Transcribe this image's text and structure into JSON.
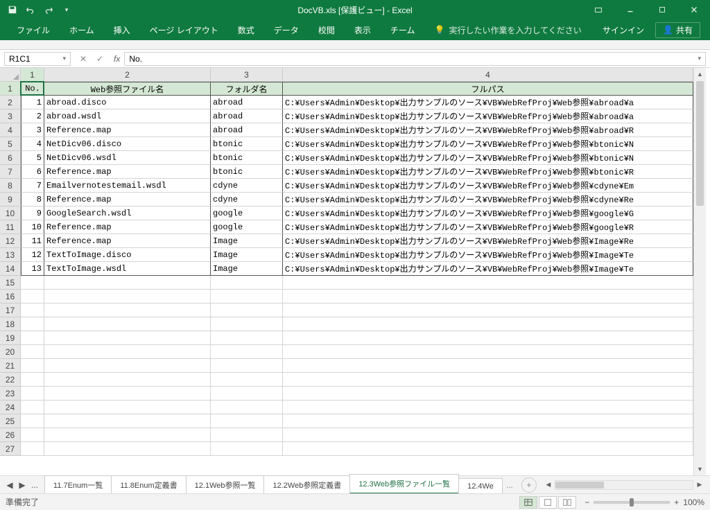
{
  "title": "DocVB.xls  [保護ビュー] - Excel",
  "signin": "サインイン",
  "share": "共有",
  "tellme": "実行したい作業を入力してください",
  "ribbon_tabs": [
    "ファイル",
    "ホーム",
    "挿入",
    "ページ レイアウト",
    "数式",
    "データ",
    "校閲",
    "表示",
    "チーム"
  ],
  "namebox": "R1C1",
  "formula": "No.",
  "col_headers": [
    "1",
    "2",
    "3",
    "4"
  ],
  "row_headers_count": 27,
  "table": {
    "headers": [
      "No.",
      "Web参照ファイル名",
      "フォルダ名",
      "フルパス"
    ],
    "rows": [
      {
        "no": 1,
        "file": "abroad.disco",
        "folder": "abroad",
        "path": "C:\\Users\\Admin\\Desktop\\出力サンプルのソース\\VB\\WebRefProj\\Web参照\\abroad\\a"
      },
      {
        "no": 2,
        "file": "abroad.wsdl",
        "folder": "abroad",
        "path": "C:\\Users\\Admin\\Desktop\\出力サンプルのソース\\VB\\WebRefProj\\Web参照\\abroad\\a"
      },
      {
        "no": 3,
        "file": "Reference.map",
        "folder": "abroad",
        "path": "C:\\Users\\Admin\\Desktop\\出力サンプルのソース\\VB\\WebRefProj\\Web参照\\abroad\\R"
      },
      {
        "no": 4,
        "file": "NetDicv06.disco",
        "folder": "btonic",
        "path": "C:\\Users\\Admin\\Desktop\\出力サンプルのソース\\VB\\WebRefProj\\Web参照\\btonic\\N"
      },
      {
        "no": 5,
        "file": "NetDicv06.wsdl",
        "folder": "btonic",
        "path": "C:\\Users\\Admin\\Desktop\\出力サンプルのソース\\VB\\WebRefProj\\Web参照\\btonic\\N"
      },
      {
        "no": 6,
        "file": "Reference.map",
        "folder": "btonic",
        "path": "C:\\Users\\Admin\\Desktop\\出力サンプルのソース\\VB\\WebRefProj\\Web参照\\btonic\\R"
      },
      {
        "no": 7,
        "file": "Emailvernotestemail.wsdl",
        "folder": "cdyne",
        "path": "C:\\Users\\Admin\\Desktop\\出力サンプルのソース\\VB\\WebRefProj\\Web参照\\cdyne\\Em"
      },
      {
        "no": 8,
        "file": "Reference.map",
        "folder": "cdyne",
        "path": "C:\\Users\\Admin\\Desktop\\出力サンプルのソース\\VB\\WebRefProj\\Web参照\\cdyne\\Re"
      },
      {
        "no": 9,
        "file": "GoogleSearch.wsdl",
        "folder": "google",
        "path": "C:\\Users\\Admin\\Desktop\\出力サンプルのソース\\VB\\WebRefProj\\Web参照\\google\\G"
      },
      {
        "no": 10,
        "file": "Reference.map",
        "folder": "google",
        "path": "C:\\Users\\Admin\\Desktop\\出力サンプルのソース\\VB\\WebRefProj\\Web参照\\google\\R"
      },
      {
        "no": 11,
        "file": "Reference.map",
        "folder": "Image",
        "path": "C:\\Users\\Admin\\Desktop\\出力サンプルのソース\\VB\\WebRefProj\\Web参照\\Image\\Re"
      },
      {
        "no": 12,
        "file": "TextToImage.disco",
        "folder": "Image",
        "path": "C:\\Users\\Admin\\Desktop\\出力サンプルのソース\\VB\\WebRefProj\\Web参照\\Image\\Te"
      },
      {
        "no": 13,
        "file": "TextToImage.wsdl",
        "folder": "Image",
        "path": "C:\\Users\\Admin\\Desktop\\出力サンプルのソース\\VB\\WebRefProj\\Web参照\\Image\\Te"
      }
    ]
  },
  "sheet_tabs": [
    "11.7Enum一覧",
    "11.8Enum定義書",
    "12.1Web参照一覧",
    "12.2Web参照定義書",
    "12.3Web参照ファイル一覧",
    "12.4We"
  ],
  "active_sheet": 4,
  "sheet_nav_more": "...",
  "status": "準備完了",
  "zoom": "100%"
}
